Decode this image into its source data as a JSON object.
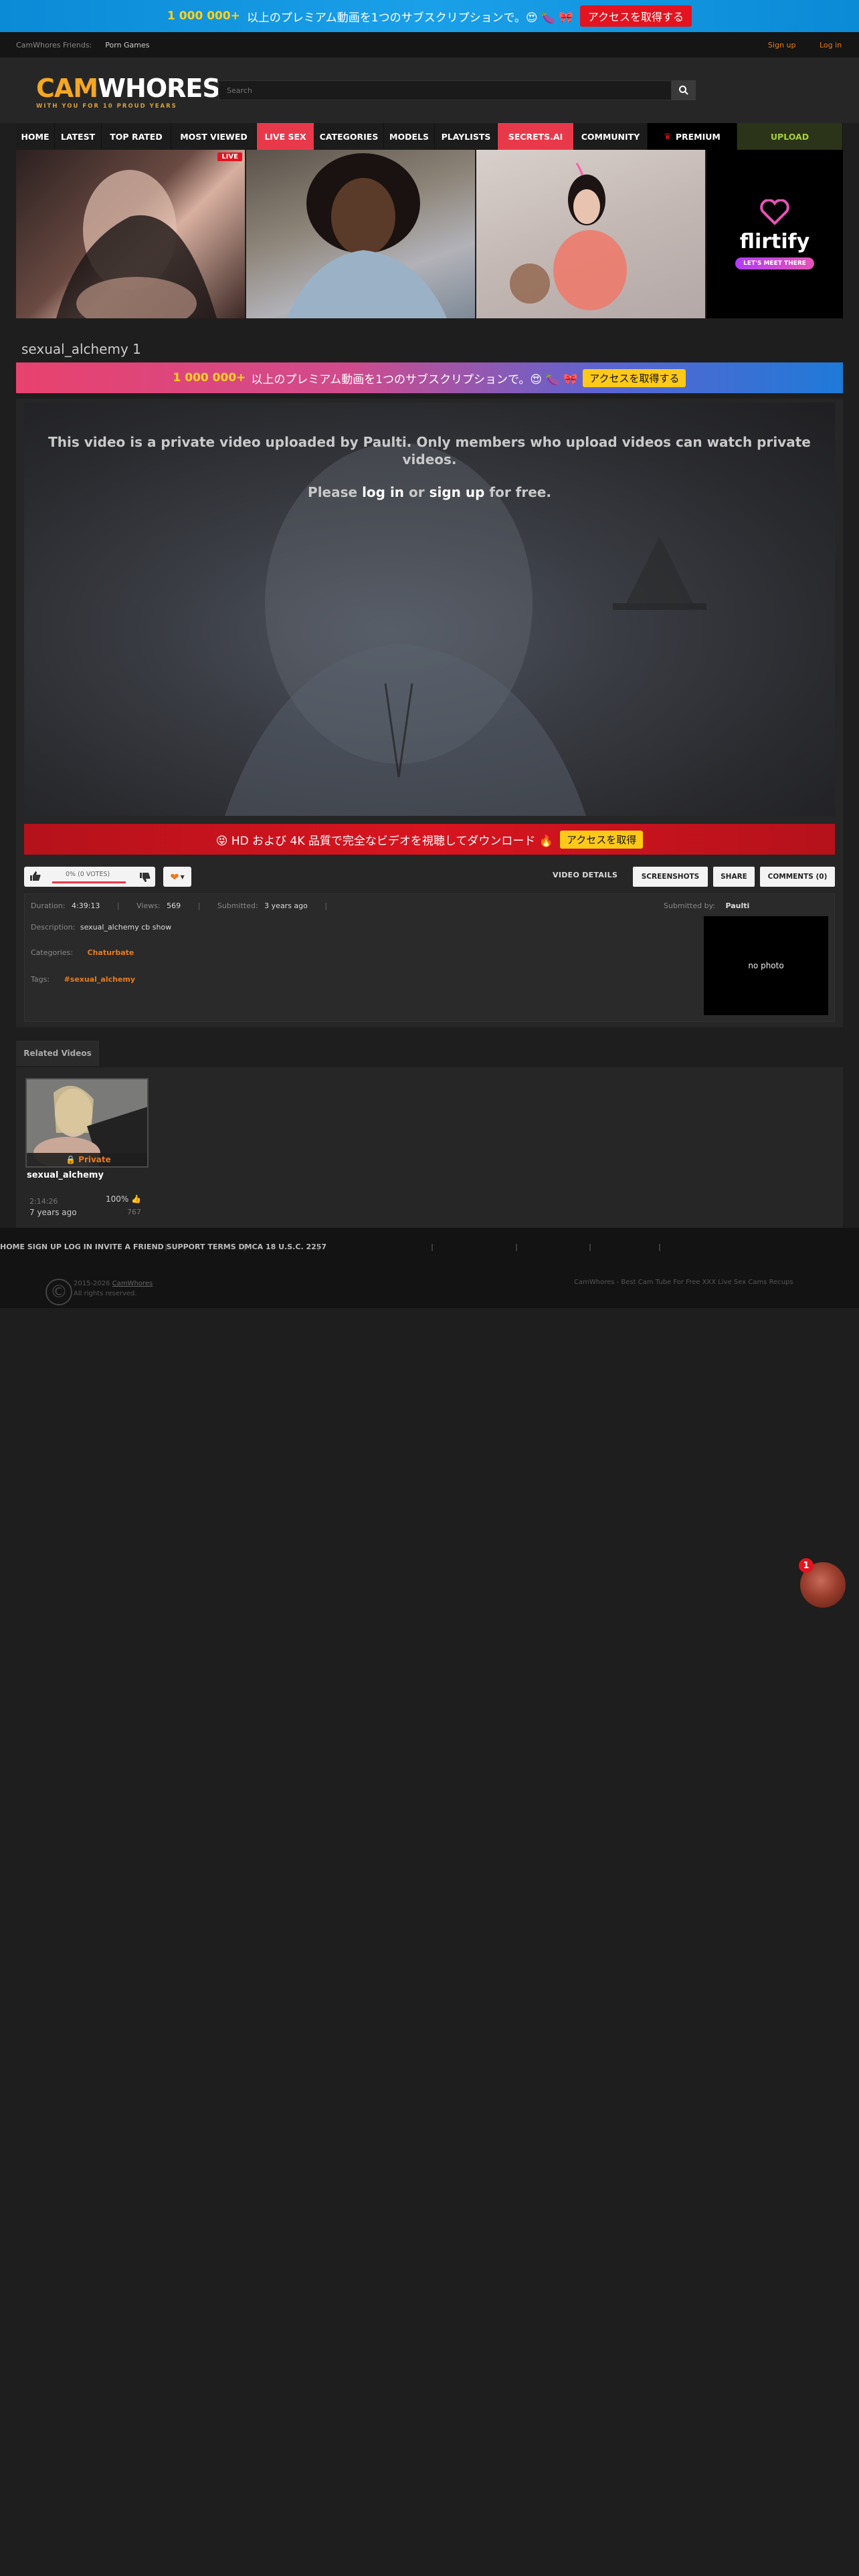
{
  "top_banner": {
    "highlight": "1 000 000+",
    "text": "以上のプレミアム動画を1つのサブスクリプションで。😍 🍆 🎀",
    "cta": "アクセスを取得する"
  },
  "friends_bar": {
    "label": "CamWhores Friends:",
    "link": "Porn Games",
    "sign_up": "Sign up",
    "log_in": "Log in"
  },
  "logo": {
    "cam": "CAM",
    "whores": "WHORES",
    "tagline": "WITH YOU FOR 10 PROUD YEARS"
  },
  "search": {
    "placeholder": "Search"
  },
  "nav": {
    "home": "HOME",
    "latest": "LATEST",
    "top_rated": "TOP RATED",
    "most_viewed": "MOST VIEWED",
    "live_sex": "LIVE SEX",
    "categories": "CATEGORIES",
    "models": "MODELS",
    "playlists": "PLAYLISTS",
    "secrets": "SECRETS.AI",
    "community": "COMMUNITY",
    "premium": "PREMIUM",
    "upload": "UPLOAD"
  },
  "cams": {
    "live_badge": "LIVE",
    "flirtify_name": "flirtify",
    "flirtify_cta": "LET'S MEET THERE"
  },
  "video": {
    "title": "sexual_alchemy 1",
    "private_msg": "This video is a private video uploaded by Paulti. Only members who upload videos can watch private videos.",
    "please": "Please",
    "log_in": "log in",
    "or": "or",
    "sign_up": "sign up",
    "for_free": "for free."
  },
  "promo2": {
    "highlight": "1 000 000+",
    "text": "以上のプレミアム動画を1つのサブスクリプションで。😍 🍆 🎀",
    "cta": "アクセスを取得する"
  },
  "hd_bar": {
    "text": "😝 HD および 4K 品質で完全なビデオを視聴してダウンロード 🔥",
    "cta": "アクセスを取得"
  },
  "rating": {
    "text": "0% (0 VOTES)"
  },
  "tabs": {
    "video_details": "VIDEO DETAILS",
    "screenshots": "SCREENSHOTS",
    "share": "SHARE",
    "comments": "COMMENTS (0)"
  },
  "details": {
    "duration_label": "Duration:",
    "duration": "4:39:13",
    "views_label": "Views:",
    "views": "569",
    "submitted_label": "Submitted:",
    "submitted": "3 years ago",
    "submitted_by_label": "Submitted by:",
    "submitted_by": "Paulti",
    "description_label": "Description:",
    "description": "sexual_alchemy cb show",
    "categories_label": "Categories:",
    "category": "Chaturbate",
    "tags_label": "Tags:",
    "tag": "#sexual_alchemy",
    "no_photo": "no photo"
  },
  "related": {
    "label": "Related Videos",
    "private": "Private",
    "title": "sexual_alchemy",
    "duration": "2:14:26",
    "rating": "100%",
    "date": "7 years ago",
    "views": "767"
  },
  "footer": {
    "home": "HOME",
    "sign_up": "SIGN UP",
    "log_in": "LOG IN",
    "invite": "INVITE A FRIEND",
    "support": "SUPPORT",
    "terms": "TERMS",
    "dmca": "DMCA",
    "usc": "18 U.S.C. 2257",
    "copyright_years": "2015-2026",
    "copyright_name": "CamWhores",
    "rights": "All rights reserved.",
    "tagline": "CamWhores - Best Cam Tube For Free XXX Live Sex Cams Recups"
  },
  "chat": {
    "badge": "1"
  },
  "colors": {
    "accent_orange": "#e87b1c",
    "live_red": "#e8394a",
    "upload_green": "#a6d23a"
  }
}
